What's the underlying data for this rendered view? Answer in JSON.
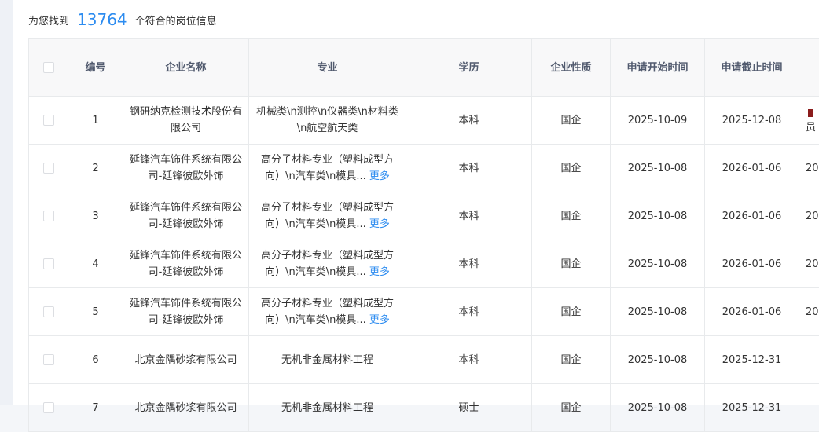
{
  "summary": {
    "prefix": "为您找到",
    "count": "13764",
    "suffix": "个符合的岗位信息"
  },
  "table": {
    "headers": [
      "编号",
      "企业名称",
      "专业",
      "学历",
      "企业性质",
      "申请开始时间",
      "申请截止时间"
    ],
    "rows": [
      {
        "no": "1",
        "company": "钢研纳克检测技术股份有限公司",
        "major": "机械类\\n测控\\n仪器类\\n材料类\\n航空航天类",
        "more": "",
        "edu": "本科",
        "nature": "国企",
        "start": "2025-10-09",
        "end": "2025-12-08",
        "extra1": "",
        "extra2": "员"
      },
      {
        "no": "2",
        "company": "延锋汽车饰件系统有限公司-延锋彼欧外饰",
        "major": "高分子材料专业（塑料成型方向）\\n汽车类\\n模具...",
        "more": "更多",
        "edu": "本科",
        "nature": "国企",
        "start": "2025-10-08",
        "end": "2026-01-06",
        "extra1": "20",
        "extra2": ""
      },
      {
        "no": "3",
        "company": "延锋汽车饰件系统有限公司-延锋彼欧外饰",
        "major": "高分子材料专业（塑料成型方向）\\n汽车类\\n模具...",
        "more": "更多",
        "edu": "本科",
        "nature": "国企",
        "start": "2025-10-08",
        "end": "2026-01-06",
        "extra1": "20",
        "extra2": ""
      },
      {
        "no": "4",
        "company": "延锋汽车饰件系统有限公司-延锋彼欧外饰",
        "major": "高分子材料专业（塑料成型方向）\\n汽车类\\n模具...",
        "more": "更多",
        "edu": "本科",
        "nature": "国企",
        "start": "2025-10-08",
        "end": "2026-01-06",
        "extra1": "20",
        "extra2": ""
      },
      {
        "no": "5",
        "company": "延锋汽车饰件系统有限公司-延锋彼欧外饰",
        "major": "高分子材料专业（塑料成型方向）\\n汽车类\\n模具...",
        "more": "更多",
        "edu": "本科",
        "nature": "国企",
        "start": "2025-10-08",
        "end": "2026-01-06",
        "extra1": "20",
        "extra2": ""
      },
      {
        "no": "6",
        "company": "北京金隅砂浆有限公司",
        "major": "无机非金属材料工程",
        "more": "",
        "edu": "本科",
        "nature": "国企",
        "start": "2025-10-08",
        "end": "2025-12-31",
        "extra1": "",
        "extra2": ""
      },
      {
        "no": "7",
        "company": "北京金隅砂浆有限公司",
        "major": "无机非金属材料工程",
        "more": "",
        "edu": "硕士",
        "nature": "国企",
        "start": "2025-10-08",
        "end": "2025-12-31",
        "extra1": "",
        "extra2": ""
      }
    ]
  },
  "colors": {
    "accent": "#2d8cf0",
    "header_bg": "#f8f8f9",
    "border": "#e8eaec",
    "flag": "#8b1c1c"
  }
}
